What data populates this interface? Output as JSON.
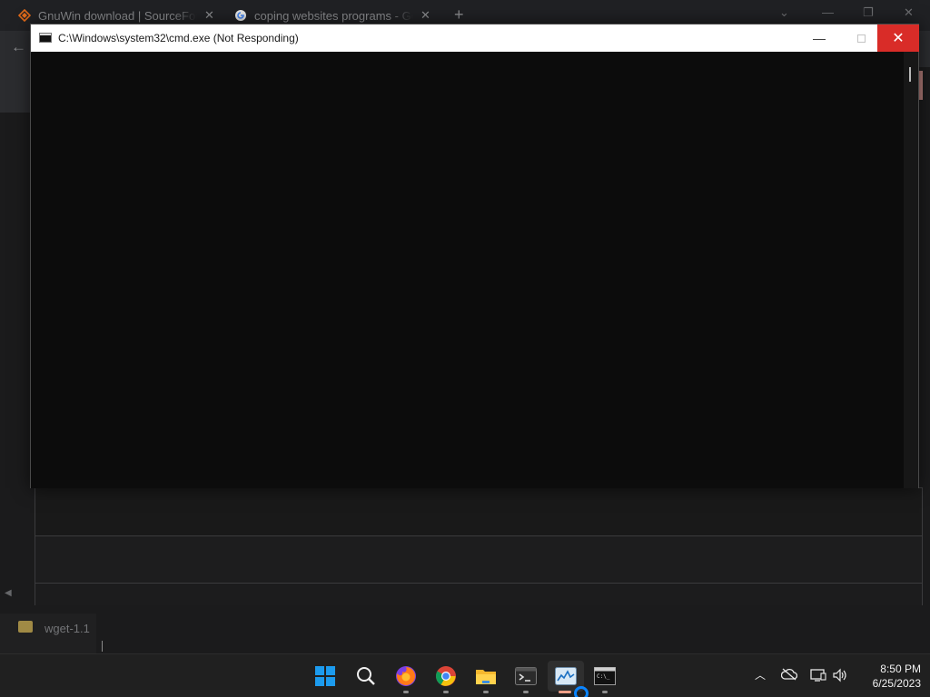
{
  "browser": {
    "tabs": [
      {
        "label": "GnuWin download | SourceForge.net"
      },
      {
        "label": "coping websites programs - Google Search"
      }
    ],
    "new_tab_glyph": "+",
    "close_glyph": "✕"
  },
  "explorer": {
    "partial_file_name": "wget-1.1"
  },
  "cmd": {
    "title": "C:\\Windows\\system32\\cmd.exe (Not Responding)",
    "minimize_glyph": "—",
    "close_glyph": "✕"
  },
  "taskbar": {
    "items": [
      "start",
      "search",
      "firefox",
      "chrome",
      "file-explorer",
      "terminal",
      "task-manager",
      "cmd"
    ],
    "time": "8:50 PM",
    "date": "6/25/2023"
  },
  "colors": {
    "cmd_close": "#d92c28",
    "windows_blue": "#1c9bee",
    "busy_ring": "#0a84ff"
  }
}
